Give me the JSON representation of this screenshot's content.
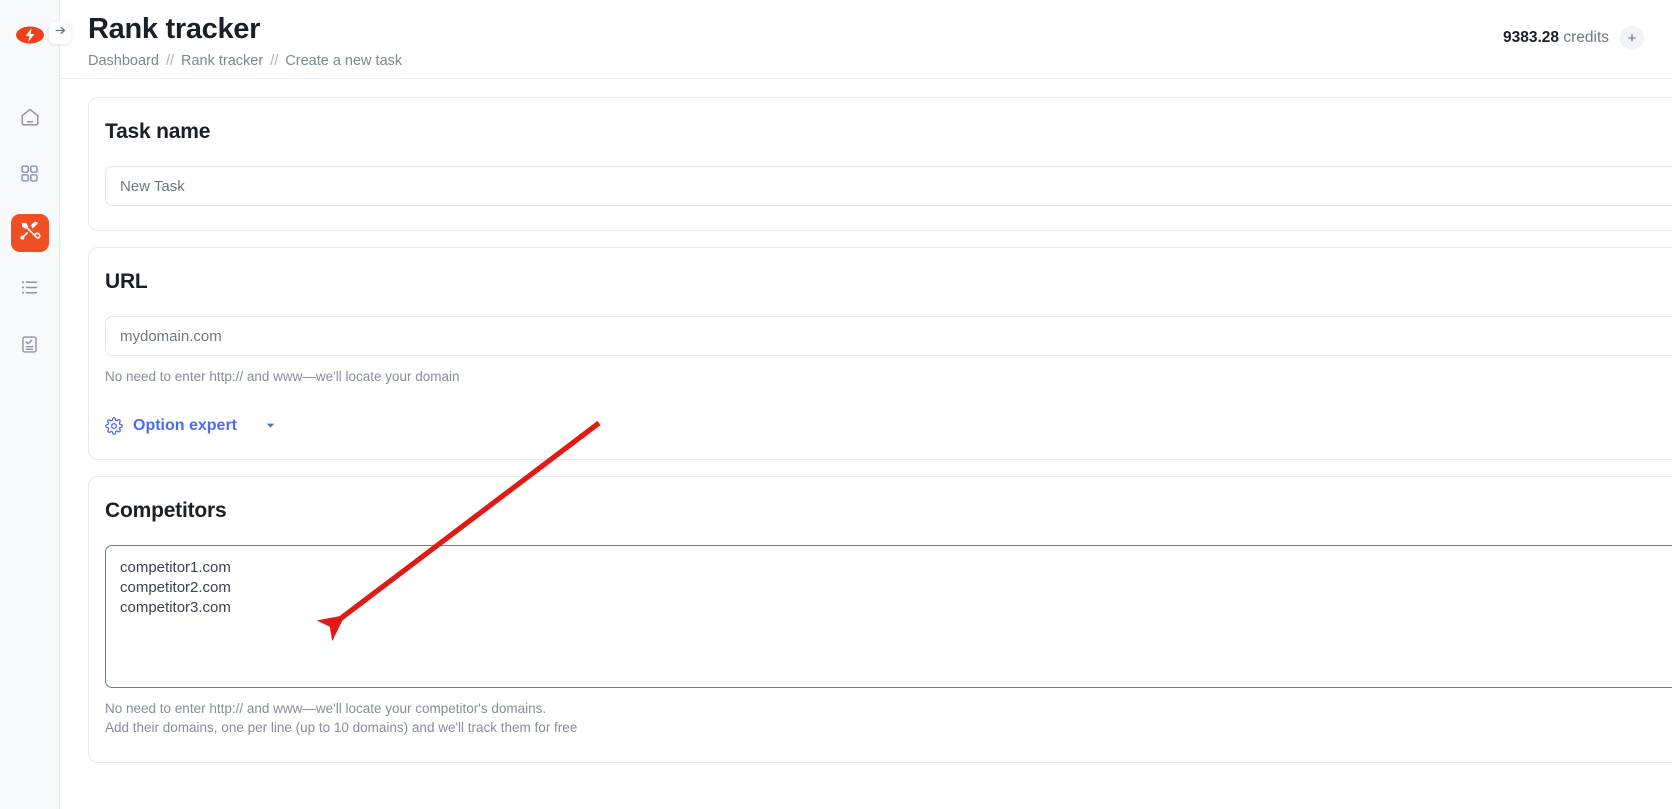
{
  "header": {
    "title": "Rank tracker",
    "breadcrumb": [
      {
        "label": "Dashboard"
      },
      {
        "label": "Rank tracker"
      },
      {
        "label": "Create a new task"
      }
    ],
    "separator": "//",
    "credits_amount": "9383.28",
    "credits_label": "credits",
    "add_credits_icon": "+"
  },
  "sidebar": {
    "logo_icon": "lightning-eye-logo",
    "toggle_icon": "arrow-right-icon",
    "items": [
      {
        "name": "home",
        "icon": "home-icon",
        "active": false
      },
      {
        "name": "apps",
        "icon": "grid-icon",
        "active": false
      },
      {
        "name": "tools",
        "icon": "tools-icon",
        "active": true
      },
      {
        "name": "lists",
        "icon": "list-icon",
        "active": false
      },
      {
        "name": "tasks",
        "icon": "clipboard-check-icon",
        "active": false
      }
    ]
  },
  "task_name": {
    "title": "Task name",
    "value": "New Task",
    "placeholder": "New Task"
  },
  "url": {
    "title": "URL",
    "value": "mydomain.com",
    "placeholder": "mydomain.com",
    "hint": "No need to enter http:// and www—we'll locate your domain",
    "option_expert_label": "Option expert",
    "option_expert_icon": "gear-icon",
    "option_expert_caret": "chevron-down-icon"
  },
  "competitors": {
    "title": "Competitors",
    "value": "competitor1.com\ncompetitor2.com\ncompetitor3.com",
    "hint_line_1": "No need to enter http:// and www—we'll locate your competitor's domains.",
    "hint_line_2": "Add their domains, one per line (up to 10 domains) and we'll track them for free"
  },
  "annotation": {
    "arrow_color": "#e01b16",
    "description": "red-arrow-pointing-to-competitors-textarea"
  },
  "colors": {
    "accent_orange": "#f04e23",
    "link_blue": "#4a6cf0",
    "focus_border": "#5b7fbe"
  }
}
